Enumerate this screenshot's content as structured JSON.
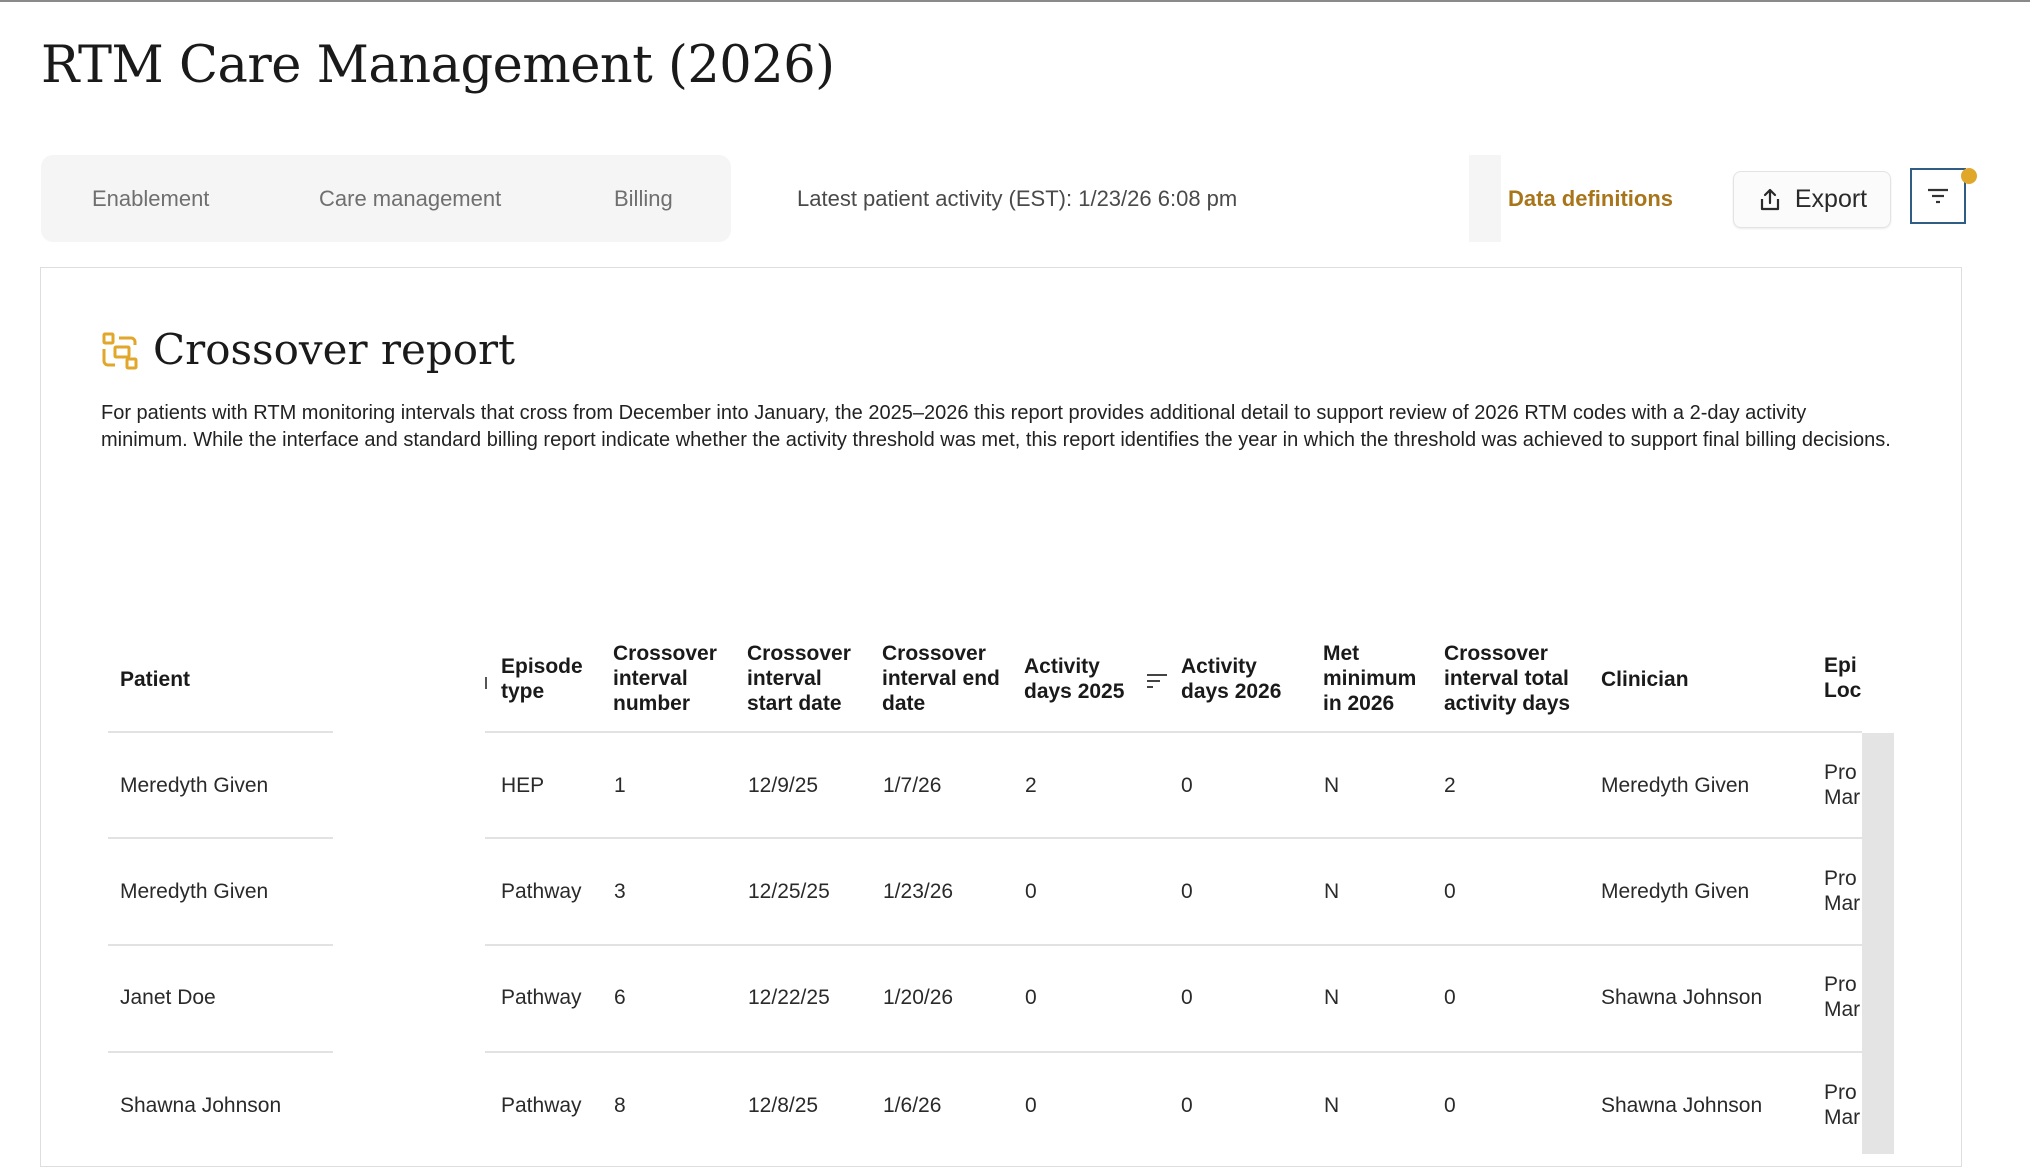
{
  "header": {
    "title": "RTM Care Management (2026)"
  },
  "tabs": [
    {
      "label": "Enablement"
    },
    {
      "label": "Care management"
    },
    {
      "label": "Billing"
    }
  ],
  "activity": "Latest patient activity (EST): 1/23/26 6:08 pm",
  "actions": {
    "data_definitions": "Data definitions",
    "export": "Export"
  },
  "report": {
    "title": "Crossover report",
    "description": "For patients with RTM monitoring intervals that cross from December into January, the 2025–2026 this report provides additional detail to support review of 2026 RTM codes with a 2-day activity minimum. While the interface and standard billing report indicate whether the activity threshold was met, this report identifies the year in which the threshold was achieved to support final billing decisions."
  },
  "table": {
    "columns": {
      "patient": [
        "Patient"
      ],
      "episode_type": [
        "Episode",
        "type"
      ],
      "interval_number": [
        "Crossover",
        "interval",
        "number"
      ],
      "start_date": [
        "Crossover",
        "interval",
        "start date"
      ],
      "end_date": [
        "Crossover",
        "interval end",
        "date"
      ],
      "days_2025": [
        "Activity",
        "days 2025"
      ],
      "days_2026": [
        "Activity",
        "days 2026"
      ],
      "met_min": [
        "Met",
        "minimum",
        "in 2026"
      ],
      "total_days": [
        "Crossover",
        "interval total",
        "activity days"
      ],
      "clinician": [
        "Clinician"
      ],
      "episode_location": [
        "Epi",
        "Loc"
      ]
    },
    "rows": [
      {
        "patient": "Meredyth Given",
        "episode_type": "HEP",
        "interval_number": "1",
        "start_date": "12/9/25",
        "end_date": "1/7/26",
        "days_2025": "2",
        "days_2026": "0",
        "met_min": "N",
        "total_days": "2",
        "clinician": "Meredyth Given",
        "loc1": "Pro",
        "loc2": "Mar"
      },
      {
        "patient": "Meredyth Given",
        "episode_type": "Pathway",
        "interval_number": "3",
        "start_date": "12/25/25",
        "end_date": "1/23/26",
        "days_2025": "0",
        "days_2026": "0",
        "met_min": "N",
        "total_days": "0",
        "clinician": "Meredyth Given",
        "loc1": "Pro",
        "loc2": "Mar"
      },
      {
        "patient": "Janet Doe",
        "episode_type": "Pathway",
        "interval_number": "6",
        "start_date": "12/22/25",
        "end_date": "1/20/26",
        "days_2025": "0",
        "days_2026": "0",
        "met_min": "N",
        "total_days": "0",
        "clinician": "Shawna Johnson",
        "loc1": "Pro",
        "loc2": "Mar"
      },
      {
        "patient": "Shawna Johnson",
        "episode_type": "Pathway",
        "interval_number": "8",
        "start_date": "12/8/25",
        "end_date": "1/6/26",
        "days_2025": "0",
        "days_2026": "0",
        "met_min": "N",
        "total_days": "0",
        "clinician": "Shawna Johnson",
        "loc1": "Pro",
        "loc2": "Mar"
      }
    ]
  },
  "colors": {
    "accent": "#a8751a",
    "badge": "#e1a72a",
    "focus": "#2f5d86"
  }
}
